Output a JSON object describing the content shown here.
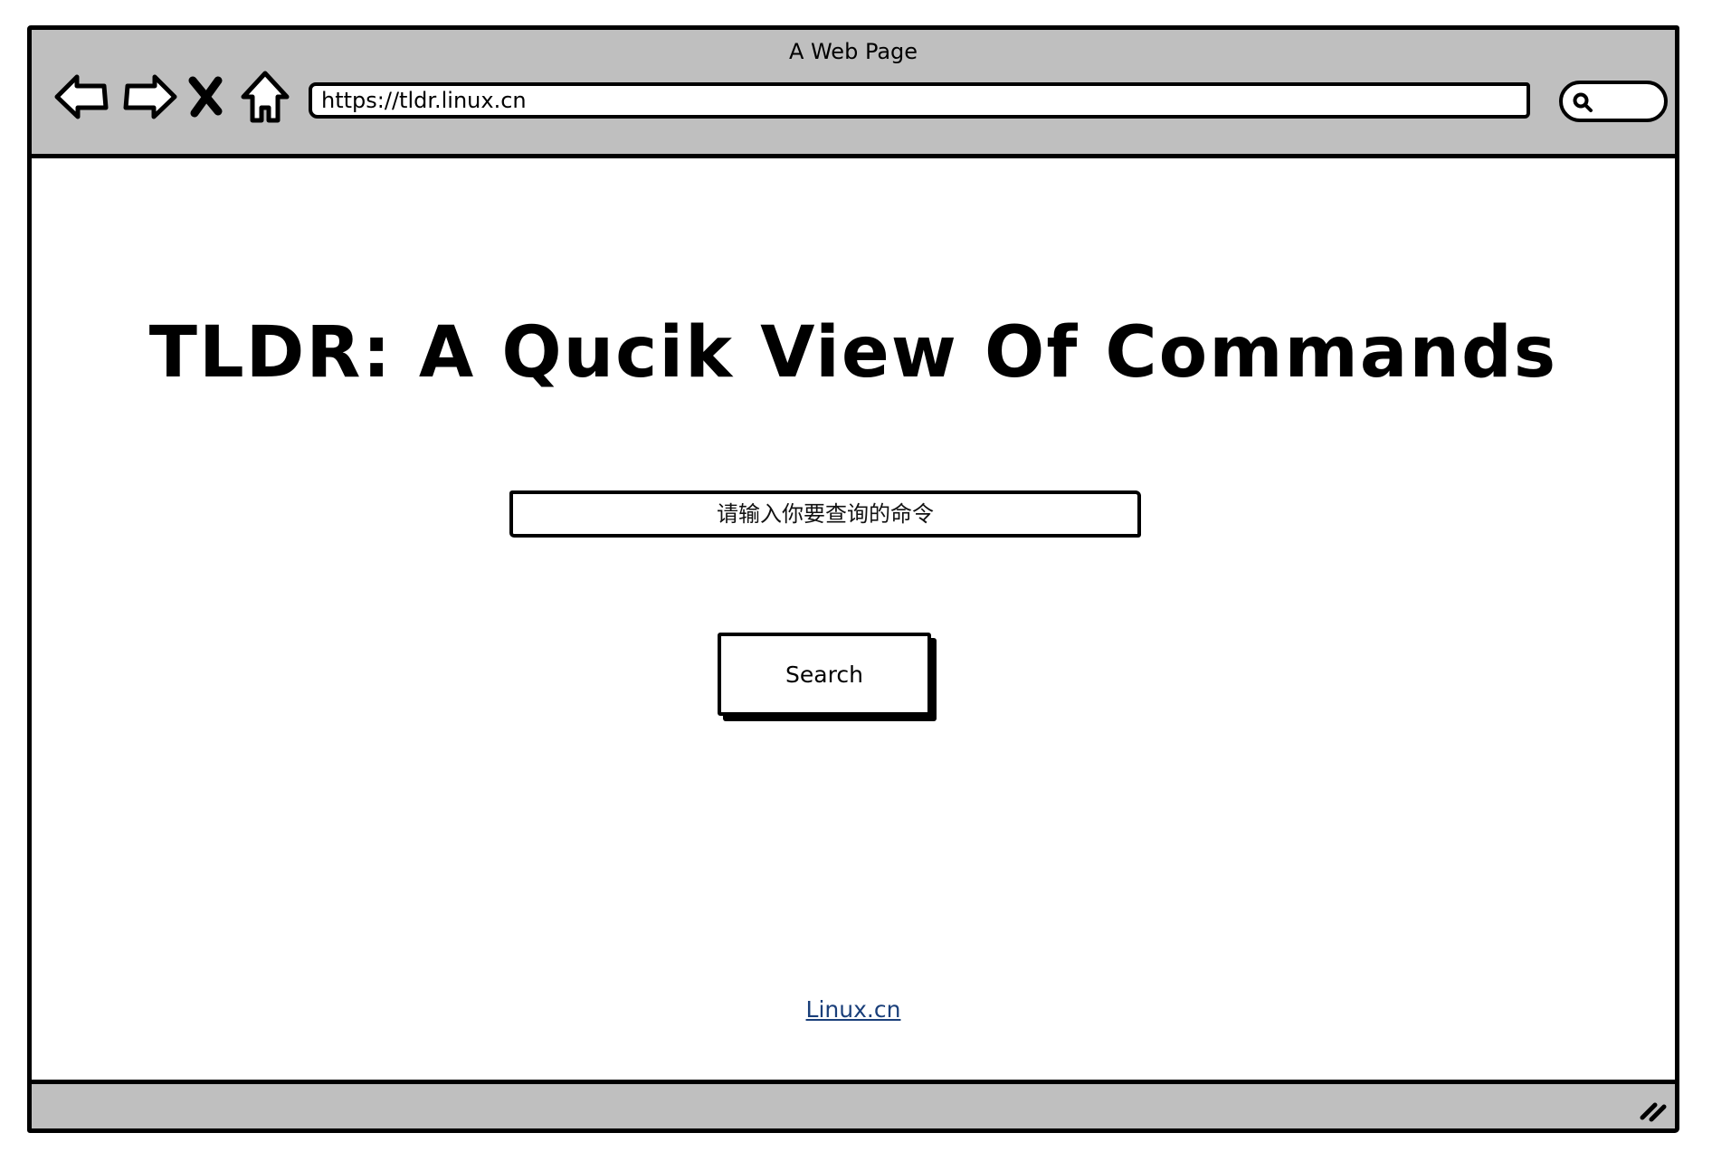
{
  "window": {
    "title": "A Web Page"
  },
  "toolbar": {
    "back_icon": "back-arrow-icon",
    "forward_icon": "forward-arrow-icon",
    "stop_icon": "close-icon",
    "home_icon": "home-icon",
    "search_icon": "search-icon"
  },
  "address_bar": {
    "url": "https://tldr.linux.cn"
  },
  "main": {
    "heading": "TLDR: A Qucik View Of Commands",
    "search_input": {
      "placeholder": "请输入你要查询的命令",
      "value": ""
    },
    "search_button_label": "Search",
    "footer_link": "Linux.cn"
  },
  "colors": {
    "chrome": "#bfbfbf",
    "border": "#000000",
    "link": "#1a3f7a"
  }
}
